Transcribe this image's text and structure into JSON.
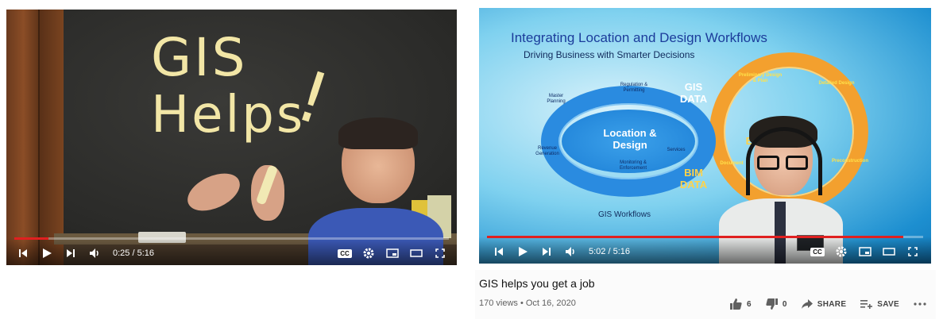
{
  "players": [
    {
      "id": "left",
      "time": "0:25 / 5:16",
      "progress_fraction": 0.079,
      "chalkboard": {
        "line1": "GIS",
        "line2": "Helps",
        "mark": "!"
      }
    },
    {
      "id": "right",
      "time": "5:02 / 5:16",
      "progress_fraction": 0.955,
      "slide": {
        "title": "Integrating Location and Design Workflows",
        "subtitle": "Driving Business with Smarter Decisions",
        "center": "Location & Design",
        "gis_data": "GIS DATA",
        "bim_data": "BIM DATA",
        "workflows": "GIS Workflows",
        "labels": {
          "master_planning": "Master Planning",
          "regulation": "Regulation & Permitting",
          "services": "Services",
          "revenue": "Revenue Generation",
          "monitoring": "Monitoring & Enforcement",
          "preliminary": "Preliminary Design & Plan",
          "detailed": "Detailed Design",
          "preconstruction": "Preconstruction",
          "documentation": "Document",
          "design_partial": "D",
          "eng_partial": "E"
        }
      }
    }
  ],
  "video": {
    "title": "GIS helps you get a job",
    "stats": "170 views • Oct 16, 2020",
    "likes": "6",
    "dislikes": "0",
    "share_label": "SHARE",
    "save_label": "SAVE"
  },
  "icons": [
    "prev-icon",
    "play-icon",
    "next-icon",
    "volume-icon",
    "cc-icon",
    "settings-icon",
    "miniplayer-icon",
    "theater-icon",
    "fullscreen-icon",
    "thumbs-up-icon",
    "thumbs-down-icon",
    "share-icon",
    "save-playlist-icon",
    "more-icon"
  ],
  "colors": {
    "progress": "#e02020",
    "chalk": "#f2e6a6",
    "slide_title": "#1b3c9b"
  }
}
